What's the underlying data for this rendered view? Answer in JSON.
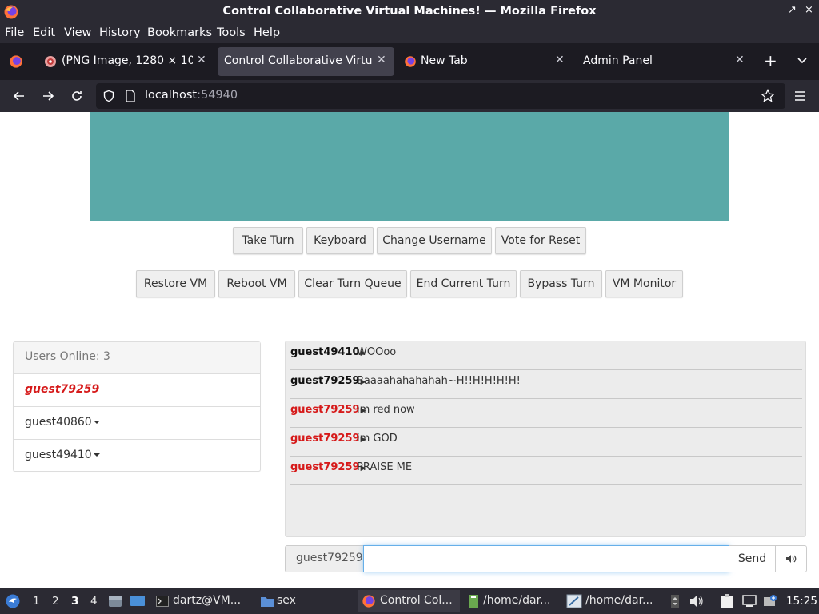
{
  "window": {
    "title": "Control Collaborative Virtual Machines! — Mozilla Firefox",
    "controls": [
      "–",
      "↗",
      "×"
    ]
  },
  "menu": [
    "File",
    "Edit",
    "View",
    "History",
    "Bookmarks",
    "Tools",
    "Help"
  ],
  "tabs": [
    {
      "label": "(PNG Image, 1280 × 102",
      "icon": "image-icon",
      "active": false
    },
    {
      "label": "Control Collaborative Virtual",
      "icon": "",
      "active": true
    },
    {
      "label": "New Tab",
      "icon": "firefox-icon",
      "active": false
    },
    {
      "label": "Admin Panel",
      "icon": "",
      "active": false
    }
  ],
  "nav": {
    "host": "localhost",
    "port": ":54940"
  },
  "controls": {
    "row1": [
      "Take Turn",
      "Keyboard",
      "Change Username",
      "Vote for Reset"
    ],
    "row2": [
      "Restore VM",
      "Reboot VM",
      "Clear Turn Queue",
      "End Current Turn",
      "Bypass Turn",
      "VM Monitor"
    ]
  },
  "users": {
    "header": "Users Online: 3",
    "list": [
      {
        "name": "guest79259",
        "self": true
      },
      {
        "name": "guest40860",
        "self": false
      },
      {
        "name": "guest49410",
        "self": false
      }
    ]
  },
  "chat": {
    "messages": [
      {
        "user": "guest49410",
        "text": "WOOoo",
        "color": "#111111"
      },
      {
        "user": "guest79259",
        "text": "Baaaahahahahah~H!!H!H!H!H!",
        "color": "#111111"
      },
      {
        "user": "guest79259",
        "text": "im red now",
        "color": "#d61a1a"
      },
      {
        "user": "guest79259",
        "text": "im GOD",
        "color": "#d61a1a"
      },
      {
        "user": "guest79259",
        "text": "PRAISE ME",
        "color": "#d61a1a"
      }
    ],
    "username": "guest79259",
    "input_value": "",
    "send_label": "Send"
  },
  "taskbar": {
    "workspaces": [
      "1",
      "2",
      "3",
      "4"
    ],
    "active_workspace": "3",
    "items": [
      {
        "label": "dartz@VM...",
        "icon": "terminal-icon"
      },
      {
        "label": "sex",
        "icon": "folder-icon"
      },
      {
        "label": "Control Col...",
        "icon": "firefox-icon"
      },
      {
        "label": "/home/dar...",
        "icon": "text-editor-icon"
      },
      {
        "label": "/home/dar...",
        "icon": "paint-icon"
      }
    ],
    "clock": "15:25"
  },
  "colors": {
    "vm_screen": "#5aa9a8",
    "chrome_dark": "#2b2a33",
    "admin_red": "#d61a1a",
    "focus_blue": "#66afe9"
  }
}
